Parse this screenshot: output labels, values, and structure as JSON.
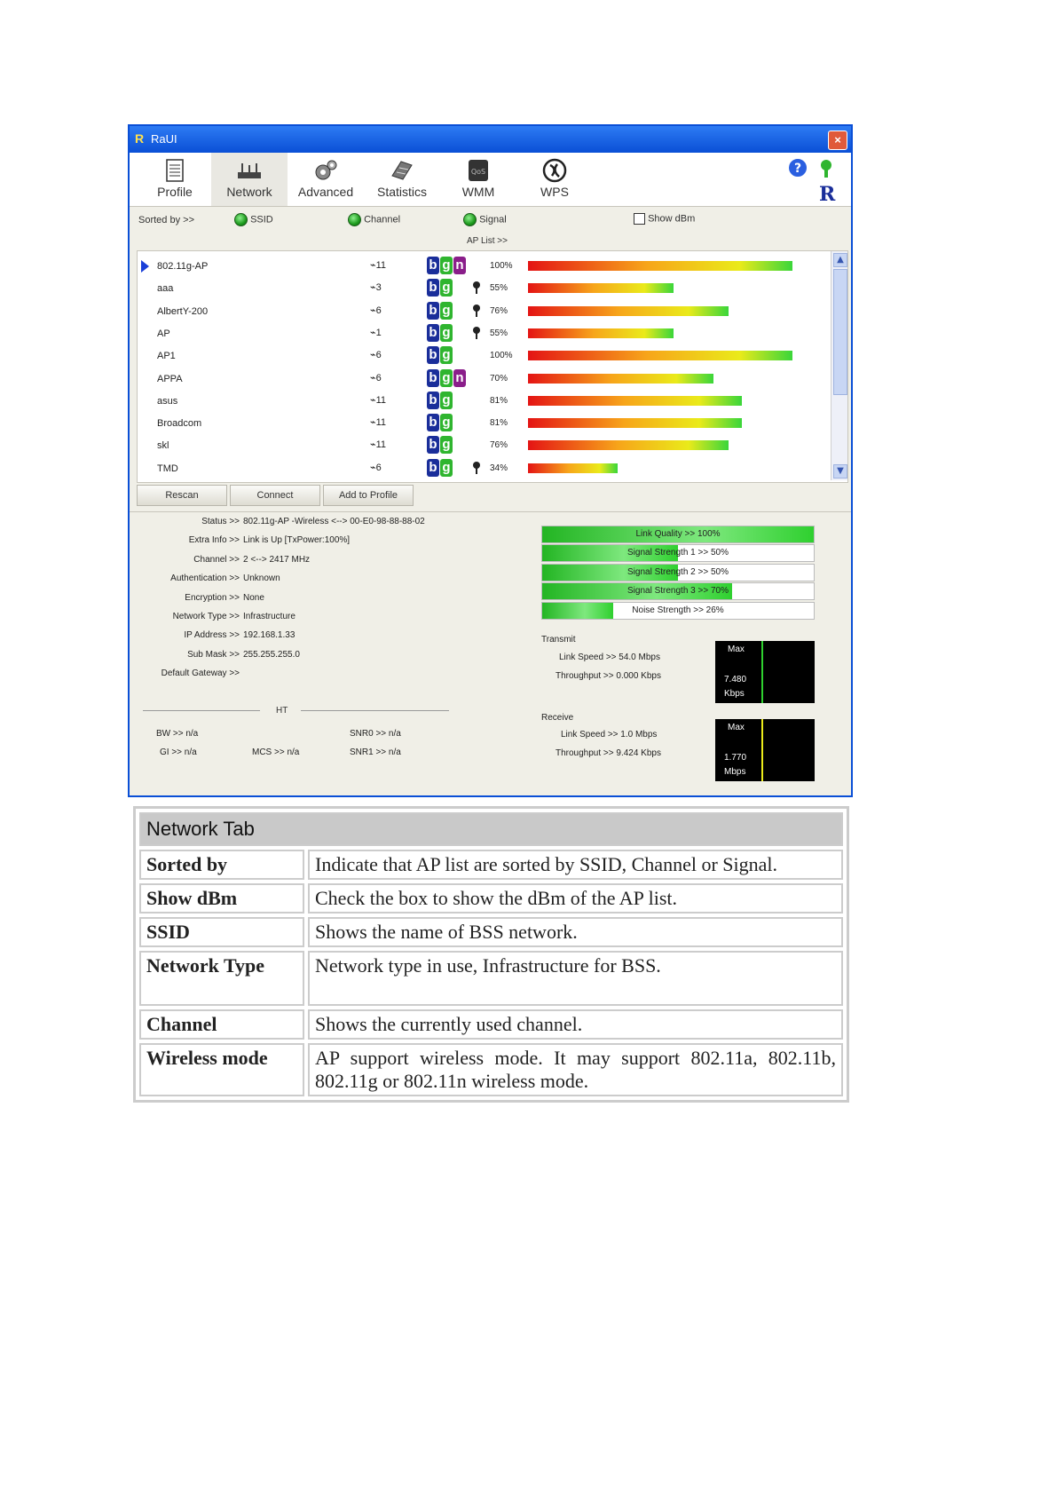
{
  "window": {
    "title": "RaUI",
    "close_glyph": "×"
  },
  "toolbar": [
    {
      "label": "Profile",
      "icon": "profile-icon"
    },
    {
      "label": "Network",
      "icon": "network-icon"
    },
    {
      "label": "Advanced",
      "icon": "advanced-icon"
    },
    {
      "label": "Statistics",
      "icon": "statistics-icon"
    },
    {
      "label": "WMM",
      "icon": "wmm-icon"
    },
    {
      "label": "WPS",
      "icon": "wps-icon"
    }
  ],
  "sort": {
    "label": "Sorted by >>",
    "ssid": "SSID",
    "channel": "Channel",
    "signal": "Signal",
    "show_dbm": "Show dBm"
  },
  "ap_list_label": "AP List >>",
  "aps": [
    {
      "ssid": "802.11g-AP",
      "channel": "11",
      "modes": [
        "b",
        "g",
        "n"
      ],
      "lock": false,
      "signal": 100,
      "pct": "100%",
      "selected": true
    },
    {
      "ssid": "aaa",
      "channel": "3",
      "modes": [
        "b",
        "g"
      ],
      "lock": true,
      "signal": 55,
      "pct": "55%"
    },
    {
      "ssid": "AlbertY-200",
      "channel": "6",
      "modes": [
        "b",
        "g"
      ],
      "lock": true,
      "signal": 76,
      "pct": "76%"
    },
    {
      "ssid": "AP",
      "channel": "1",
      "modes": [
        "b",
        "g"
      ],
      "lock": true,
      "signal": 55,
      "pct": "55%"
    },
    {
      "ssid": "AP1",
      "channel": "6",
      "modes": [
        "b",
        "g"
      ],
      "lock": false,
      "signal": 100,
      "pct": "100%"
    },
    {
      "ssid": "APPA",
      "channel": "6",
      "modes": [
        "b",
        "g",
        "n"
      ],
      "lock": false,
      "signal": 70,
      "pct": "70%"
    },
    {
      "ssid": "asus",
      "channel": "11",
      "modes": [
        "b",
        "g"
      ],
      "lock": false,
      "signal": 81,
      "pct": "81%"
    },
    {
      "ssid": "Broadcom",
      "channel": "11",
      "modes": [
        "b",
        "g"
      ],
      "lock": false,
      "signal": 81,
      "pct": "81%"
    },
    {
      "ssid": "skl",
      "channel": "11",
      "modes": [
        "b",
        "g"
      ],
      "lock": false,
      "signal": 76,
      "pct": "76%"
    },
    {
      "ssid": "TMD",
      "channel": "6",
      "modes": [
        "b",
        "g"
      ],
      "lock": true,
      "signal": 34,
      "pct": "34%"
    }
  ],
  "buttons": {
    "rescan": "Rescan",
    "connect": "Connect",
    "add_to_profile": "Add to Profile"
  },
  "info": [
    {
      "k": "Status >>",
      "v": "802.11g-AP -Wireless <--> 00-E0-98-88-88-02"
    },
    {
      "k": "Extra Info >>",
      "v": "Link is Up [TxPower:100%]"
    },
    {
      "k": "Channel >>",
      "v": "2 <--> 2417 MHz"
    },
    {
      "k": "Authentication >>",
      "v": "Unknown"
    },
    {
      "k": "Encryption >>",
      "v": "None"
    },
    {
      "k": "Network Type >>",
      "v": "Infrastructure"
    },
    {
      "k": "IP Address >>",
      "v": "192.168.1.33"
    },
    {
      "k": "Sub Mask >>",
      "v": "255.255.255.0"
    },
    {
      "k": "Default Gateway >>",
      "v": ""
    }
  ],
  "ht": {
    "title": "HT",
    "bw": "BW >> n/a",
    "gi": "GI >> n/a",
    "mcs": "MCS >> n/a",
    "snr0": "SNR0 >> n/a",
    "snr1": "SNR1 >> n/a"
  },
  "meters": [
    {
      "label": "Link Quality >> 100%",
      "value": 1.0
    },
    {
      "label": "Signal Strength 1 >> 50%",
      "value": 0.5
    },
    {
      "label": "Signal Strength 2 >> 50%",
      "value": 0.5
    },
    {
      "label": "Signal Strength 3 >> 70%",
      "value": 0.7
    },
    {
      "label": "Noise Strength >> 26%",
      "value": 0.26
    }
  ],
  "transmit": {
    "title": "Transmit",
    "link_speed": "Link Speed >> 54.0 Mbps",
    "throughput": "Throughput >> 0.000 Kbps",
    "max": "Max",
    "value": "7.480",
    "unit": "Kbps",
    "line_color": "#2fd02f"
  },
  "receive": {
    "title": "Receive",
    "link_speed": "Link Speed >> 1.0 Mbps",
    "throughput": "Throughput >> 9.424 Kbps",
    "max": "Max",
    "value": "1.770",
    "unit": "Mbps",
    "line_color": "#eaea1a"
  },
  "doc": {
    "header": "Network Tab",
    "rows": [
      {
        "k": "Sorted by",
        "v": "Indicate that AP list are sorted by SSID, Channel or Signal."
      },
      {
        "k": "Show dBm",
        "v": "Check the box to show the dBm of the AP list."
      },
      {
        "k": "SSID",
        "v": "Shows the name of BSS network."
      },
      {
        "k": "Network Type",
        "v": "Network type in use, Infrastructure for BSS."
      },
      {
        "k": "Channel",
        "v": "Shows the currently used channel."
      },
      {
        "k": "Wireless mode",
        "v": "AP support wireless mode. It may support 802.11a, 802.11b, 802.11g or 802.11n wireless mode."
      }
    ]
  }
}
